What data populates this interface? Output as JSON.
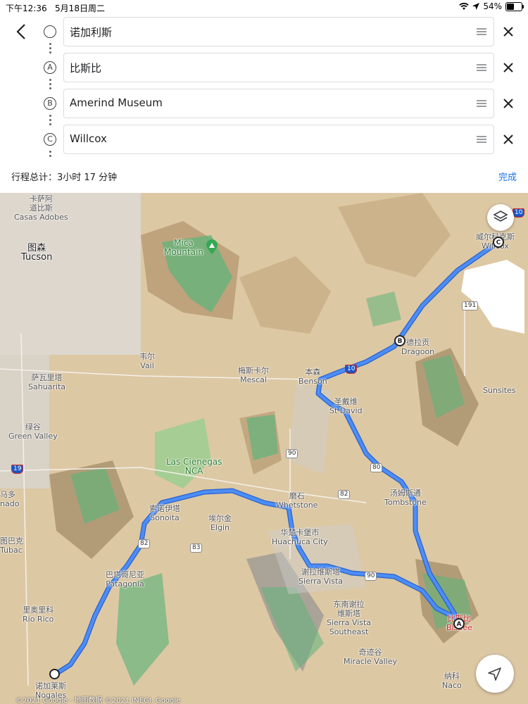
{
  "status_bar": {
    "time": "下午12:36",
    "date": "5月18日周二",
    "battery": "54%",
    "battery_level": 0.54
  },
  "directions": {
    "back_icon": "chevron-left-icon",
    "stops": [
      {
        "marker": "",
        "name": "诺加利斯"
      },
      {
        "marker": "A",
        "name": "比斯比"
      },
      {
        "marker": "B",
        "name": "Amerind Museum"
      },
      {
        "marker": "C",
        "name": "Willcox"
      }
    ],
    "total_label": "行程总计：3小时 17 分钟",
    "done_label": "完成"
  },
  "map": {
    "labels": {
      "casas_adobes_cn": "卡萨阿",
      "casas_adobes_cn2": "道比斯",
      "casas_adobes": "Casas Adobes",
      "tucson_cn": "图森",
      "tucson": "Tucson",
      "mica": "Mica",
      "mica2": "Mountain",
      "vail_cn": "韦尔",
      "vail": "Vail",
      "sahuarita_cn": "萨瓦里塔",
      "sahuarita": "Sahuarita",
      "green_valley_cn": "绿谷",
      "green_valley": "Green Valley",
      "amado_cn": "马多",
      "amado": "nado",
      "tubac_cn": "图巴克",
      "tubac": "Tubac",
      "rio_rico_cn": "里奥里科",
      "rio_rico": "Rio Rico",
      "nogales_cn": "诺加莱斯",
      "nogales": "Nogales",
      "mescal_cn": "梅斯卡尔",
      "mescal": "Mescal",
      "benson_cn": "本森",
      "benson": "Benson",
      "st_david_cn": "圣戴维",
      "st_david": "St David",
      "dragoon_cn": "德拉贡",
      "dragoon": "Dragoon",
      "willcox_cn": "威尔科克斯",
      "willcox": "Willcox",
      "sunsites": "Sunsites",
      "las_cienegas": "Las Cienegas",
      "nca": "NCA",
      "sonoita_cn": "索诺伊塔",
      "sonoita": "Sonoita",
      "elgin_cn": "埃尔金",
      "elgin": "Elgin",
      "whetstone_cn": "磨石",
      "whetstone": "Whetstone",
      "huachuca_cn": "华楚卡堡市",
      "huachuca": "Huachuca City",
      "tombstone_cn": "汤姆斯通",
      "tombstone": "Tombstone",
      "patagonia_cn": "巴塔哥尼亚",
      "patagonia": "Patagonia",
      "sierra_vista_cn": "谢拉维斯塔",
      "sierra_vista": "Sierra Vista",
      "sv_southeast_cn": "东南谢拉",
      "sv_southeast_cn2": "维斯塔",
      "sv_southeast": "Sierra Vista",
      "sv_southeast2": "Southeast",
      "miracle_valley_cn": "奇迹谷",
      "miracle_valley": "Miracle Valley",
      "bisbee_cn": "比斯比",
      "bisbee": "Bisbee",
      "naco_cn": "纳科",
      "naco": "Naco"
    },
    "shields": {
      "i10_a": "10",
      "i10_b": "10",
      "us191": "191",
      "sr90_a": "90",
      "sr90_b": "90",
      "sr80": "80",
      "sr82_a": "82",
      "sr82_b": "82",
      "sr83": "83",
      "i19": "19"
    },
    "pins": {
      "a": "A",
      "b": "B",
      "c": "C"
    },
    "copyright": "©2021 Google · 地图数据 ©2021 INEGI, Google",
    "colors": {
      "route": "#4c8df6",
      "route_border": "#2a62c9",
      "terrain": "#ddc8a4",
      "park": "#5fb47a"
    }
  }
}
